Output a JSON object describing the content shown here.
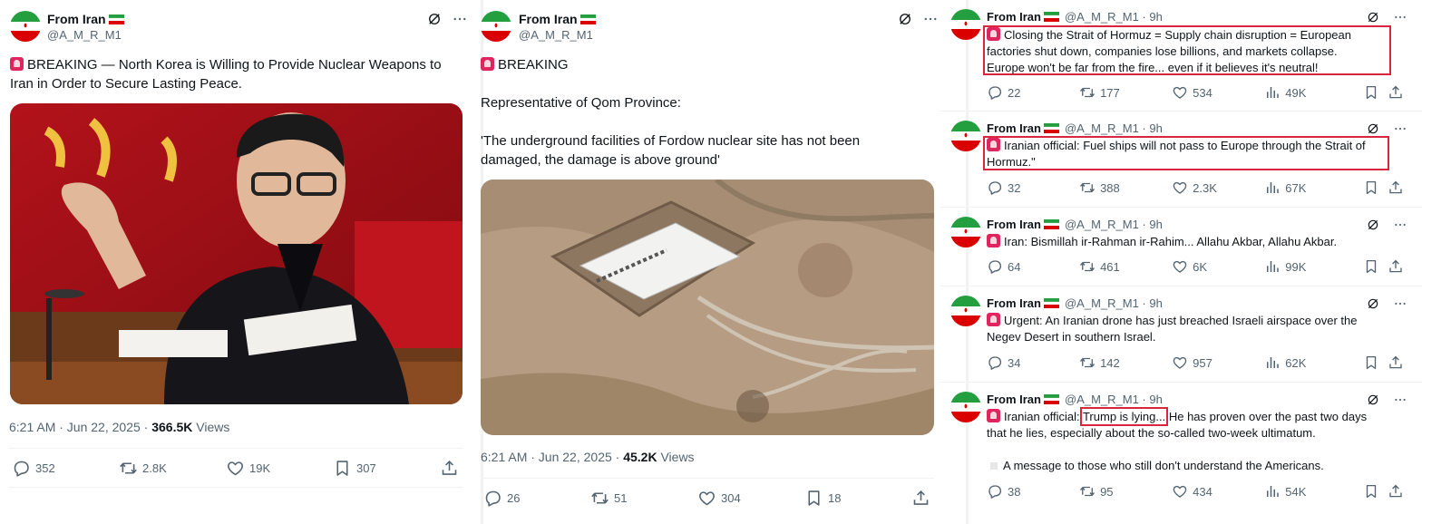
{
  "post1": {
    "author_name": "From Iran",
    "handle": "@A_M_R_M1",
    "text": "BREAKING — North Korea is Willing to Provide Nuclear Weapons to Iran in Order to Secure Lasting Peace.",
    "text_line1": "BREAKING — North Korea is Willing to Provide Nuclear Weapons to",
    "text_line2": "Iran in Order to Secure Lasting Peace.",
    "timestamp": "6:21 AM · Jun 22, 2025 · ",
    "views_count": "366.5K",
    "views_label": " Views",
    "replies": "352",
    "reposts": "2.8K",
    "likes": "19K",
    "bookmarks": "307"
  },
  "post2": {
    "author_name": "From Iran",
    "handle": "@A_M_R_M1",
    "line1": "BREAKING",
    "line2": "Representative of Qom Province:",
    "line3": "'The underground facilities of Fordow nuclear site has not been",
    "line4": "damaged, the damage is above ground'",
    "timestamp": "6:21 AM · Jun 22, 2025 · ",
    "views_count": "45.2K",
    "views_label": " Views",
    "replies": "26",
    "reposts": "51",
    "likes": "304",
    "bookmarks": "18"
  },
  "thread": [
    {
      "author_name": "From Iran",
      "handle": "@A_M_R_M1",
      "time": "9h",
      "lines": [
        "Closing the Strait of Hormuz = Supply chain disruption = European",
        "factories shut down, companies lose billions, and markets collapse.",
        "Europe won't be far from the fire... even if it believes it's neutral!"
      ],
      "replies": "22",
      "reposts": "177",
      "likes": "534",
      "views": "49K"
    },
    {
      "author_name": "From Iran",
      "handle": "@A_M_R_M1",
      "time": "9h",
      "lines": [
        "Iranian official: Fuel ships will not pass to Europe through the Strait of",
        "Hormuz.\""
      ],
      "replies": "32",
      "reposts": "388",
      "likes": "2.3K",
      "views": "67K"
    },
    {
      "author_name": "From Iran",
      "handle": "@A_M_R_M1",
      "time": "9h",
      "lines": [
        "Iran: Bismillah ir-Rahman ir-Rahim... Allahu Akbar, Allahu Akbar."
      ],
      "replies": "64",
      "reposts": "461",
      "likes": "6K",
      "views": "99K"
    },
    {
      "author_name": "From Iran",
      "handle": "@A_M_R_M1",
      "time": "9h",
      "lines": [
        "Urgent: An Iranian drone has just breached Israeli airspace over the",
        "Negev Desert in southern Israel."
      ],
      "replies": "34",
      "reposts": "142",
      "likes": "957",
      "views": "62K"
    },
    {
      "author_name": "From Iran",
      "handle": "@A_M_R_M1",
      "time": "9h",
      "line1_pre": "Iranian official: ",
      "line1_highlight": "Trump is lying...",
      "line1_post": " He has proven over the past two days",
      "line2": "that he lies, especially about the so-called two-week ultimatum.",
      "line3": "A message to those who still don't understand the Americans.",
      "replies": "38",
      "reposts": "95",
      "likes": "434",
      "views": "54K"
    }
  ],
  "colors": {
    "accent_red": "#d7263d",
    "text_primary": "#0f1419",
    "text_secondary": "#536471",
    "flag_green": "#239f40",
    "flag_red": "#da0000"
  },
  "icons": {
    "reply": "reply-icon",
    "repost": "repost-icon",
    "like": "heart-icon",
    "views": "views-icon",
    "bookmark": "bookmark-icon",
    "share": "share-icon",
    "grok": "grok-icon",
    "more": "more-icon",
    "siren": "siren-emoji"
  }
}
